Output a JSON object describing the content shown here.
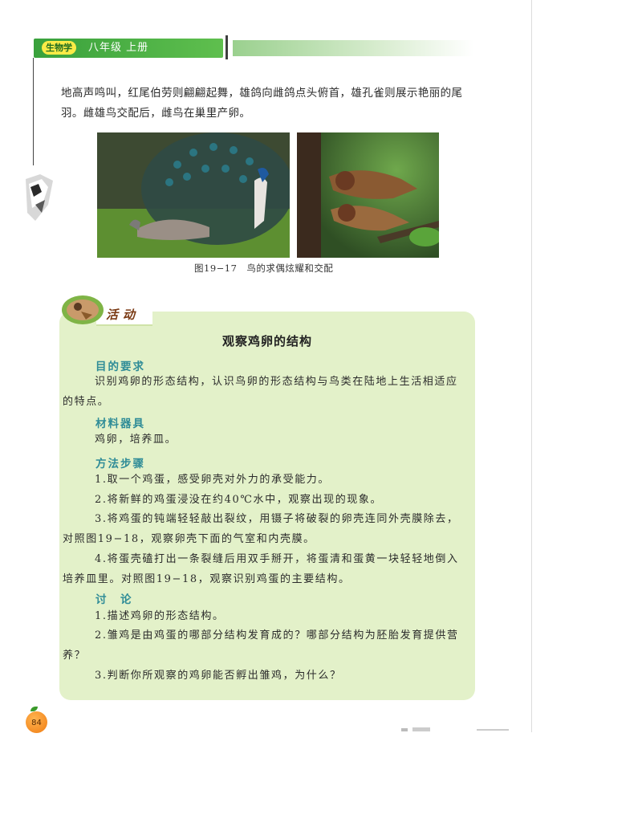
{
  "header": {
    "subject": "生物学",
    "grade": "八年级  上册"
  },
  "intro_text": "地高声鸣叫，红尾伯劳则翩翩起舞，雄鸽向雌鸽点头俯首，雄孔雀则展示艳丽的尾羽。雌雄鸟交配后，雌鸟在巢里产卵。",
  "figure": {
    "caption": "图19−17　鸟的求偶炫耀和交配"
  },
  "activity": {
    "label": "活动",
    "title": "观察鸡卵的结构",
    "sections": {
      "aim_heading": "目的要求",
      "aim_text": "识别鸡卵的形态结构，认识鸟卵的形态结构与鸟类在陆地上生活相适应的特点。",
      "materials_heading": "材料器具",
      "materials_text": "鸡卵，培养皿。",
      "method_heading": "方法步骤",
      "steps": [
        "1.取一个鸡蛋，感受卵壳对外力的承受能力。",
        "2.将新鲜的鸡蛋浸没在约40℃水中，观察出现的现象。",
        "3.将鸡蛋的钝端轻轻敲出裂纹，用镊子将破裂的卵壳连同外壳膜除去，对照图19−18，观察卵壳下面的气室和内壳膜。",
        "4.将蛋壳磕打出一条裂缝后用双手掰开，将蛋清和蛋黄一块轻轻地倒入培养皿里。对照图19−18，观察识别鸡蛋的主要结构。"
      ],
      "discussion_heading": "讨　论",
      "questions": [
        "1.描述鸡卵的形态结构。",
        "2.雏鸡是由鸡蛋的哪部分结构发育成的？哪部分结构为胚胎发育提供营养？",
        "3.判断你所观察的鸡卵能否孵出雏鸡，为什么？"
      ]
    }
  },
  "page_number": "84",
  "colors": {
    "header_green": "#39a13c",
    "activity_bg": "#e3f1c9",
    "heading_teal": "#2f8c97",
    "badge_yellow": "#fbeb46"
  }
}
